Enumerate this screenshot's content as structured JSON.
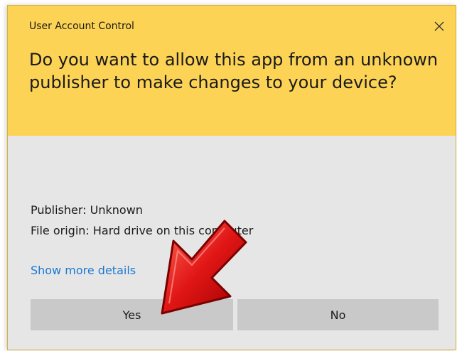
{
  "dialog": {
    "title": "User Account Control",
    "question": "Do you want to allow this app from an unknown publisher to make changes to your device?",
    "publisher": "Publisher: Unknown",
    "file_origin": "File origin: Hard drive on this computer",
    "details_link": "Show more details",
    "yes_label": "Yes",
    "no_label": "No"
  },
  "colors": {
    "header": "#fcd354",
    "body": "#e6e6e6",
    "button": "#c9c9c9",
    "link": "#1a79d0",
    "arrow": "#e01515"
  },
  "icons": {
    "close": "close-icon",
    "arrow": "red-pointer-arrow"
  }
}
